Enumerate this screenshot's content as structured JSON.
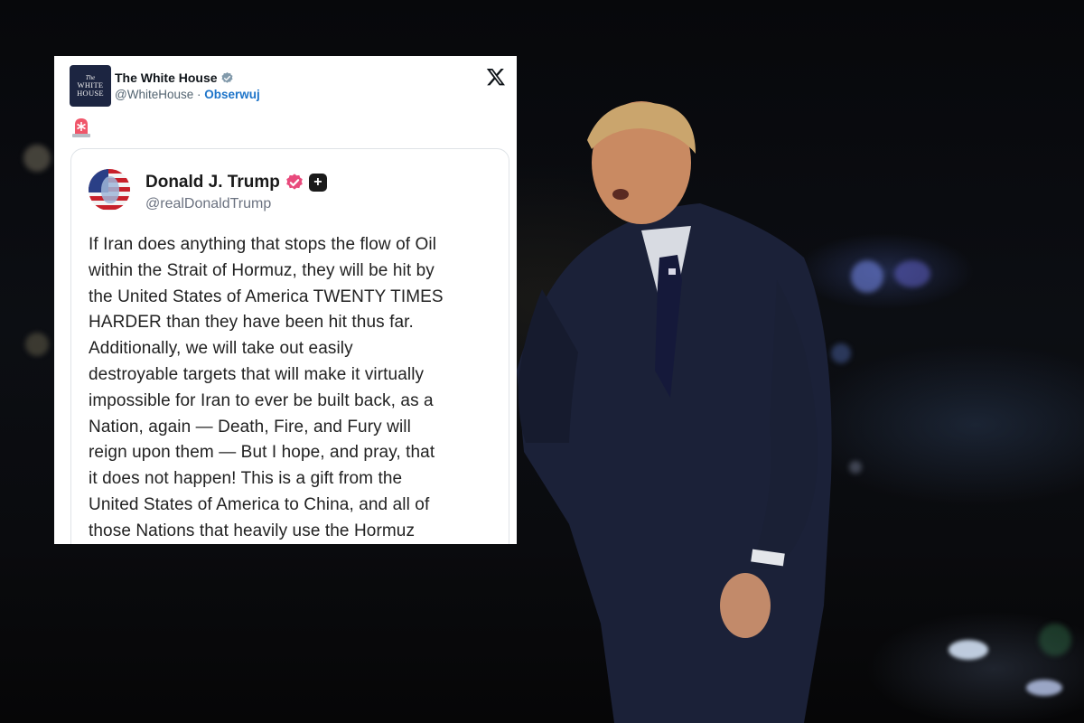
{
  "tweet": {
    "account_name": "The White House",
    "handle": "@WhiteHouse",
    "separator": "·",
    "follow_label": "Obserwuj",
    "avatar_text_small": "The",
    "avatar_text_line1": "WHITE",
    "avatar_text_line2": "HOUSE",
    "verified_icon": "verified-badge-icon",
    "platform_icon": "x-logo-icon",
    "emoji_icon": "siren-icon"
  },
  "quoted_post": {
    "author_name": "Donald J. Trump",
    "author_handle": "@realDonaldTrump",
    "badges": [
      "pink-verified-badge-icon",
      "plus-badge-icon"
    ],
    "badge_plus_glyph": "+",
    "body_lines": [
      "If Iran does anything that stops the flow of Oil",
      "within the Strait of Hormuz, they will be hit by",
      "the United States of America TWENTY TIMES",
      "HARDER than they have been hit thus far.",
      "Additionally, we will take out easily",
      "destroyable targets that will make it virtually",
      "impossible for Iran to ever be built back, as a",
      "Nation, again — Death, Fire, and Fury will",
      "reign upon them — But I hope, and pray, that",
      "it does not happen! This is a gift from the",
      "United States of America to China, and all of",
      "those Nations that heavily use the Hormuz"
    ]
  },
  "colors": {
    "link_blue": "#1d74c9",
    "verified_blue": "#829aab",
    "truth_pink": "#e84a7c",
    "background_night": "#07080b"
  }
}
